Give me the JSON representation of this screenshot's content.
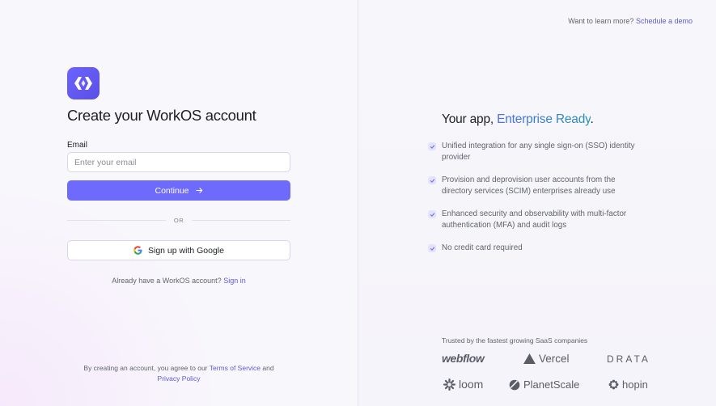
{
  "signup": {
    "title": "Create your WorkOS account",
    "email_label": "Email",
    "email_placeholder": "Enter your email",
    "email_value": "",
    "continue_label": "Continue",
    "or_label": "OR",
    "google_label": "Sign up with Google",
    "have_account_text": "Already have a WorkOS account?",
    "sign_in_link": "Sign in",
    "terms_prefix": "By creating an account, you agree to our",
    "terms_link": "Terms of Service",
    "terms_and": "and",
    "privacy_link": "Privacy Policy"
  },
  "header": {
    "learn_more_text": "Want to learn more?",
    "schedule_demo_link": "Schedule a demo"
  },
  "marketing": {
    "headline_prefix": "Your app,",
    "headline_accent": "Enterprise Ready",
    "headline_suffix": ".",
    "features": [
      "Unified integration for any single sign-on (SSO) identity provider",
      "Provision and deprovision user accounts from the directory services (SCIM) enterprises already use",
      "Enhanced security and observability with multi-factor authentication (MFA) and audit logs",
      "No credit card required"
    ],
    "trusted_text": "Trusted by the fastest growing SaaS companies",
    "logos": [
      "webflow",
      "Vercel",
      "DRATA",
      "loom",
      "PlanetScale",
      "hopin"
    ]
  },
  "colors": {
    "primary": "#6e6afc",
    "link": "#5b5bd6",
    "accent_gradient_start": "#4c6fe8",
    "accent_gradient_end": "#2a90b0"
  },
  "icons": {
    "logo": "workos-logo-icon",
    "arrow": "arrow-right-icon",
    "google": "google-icon",
    "check": "check-icon"
  }
}
